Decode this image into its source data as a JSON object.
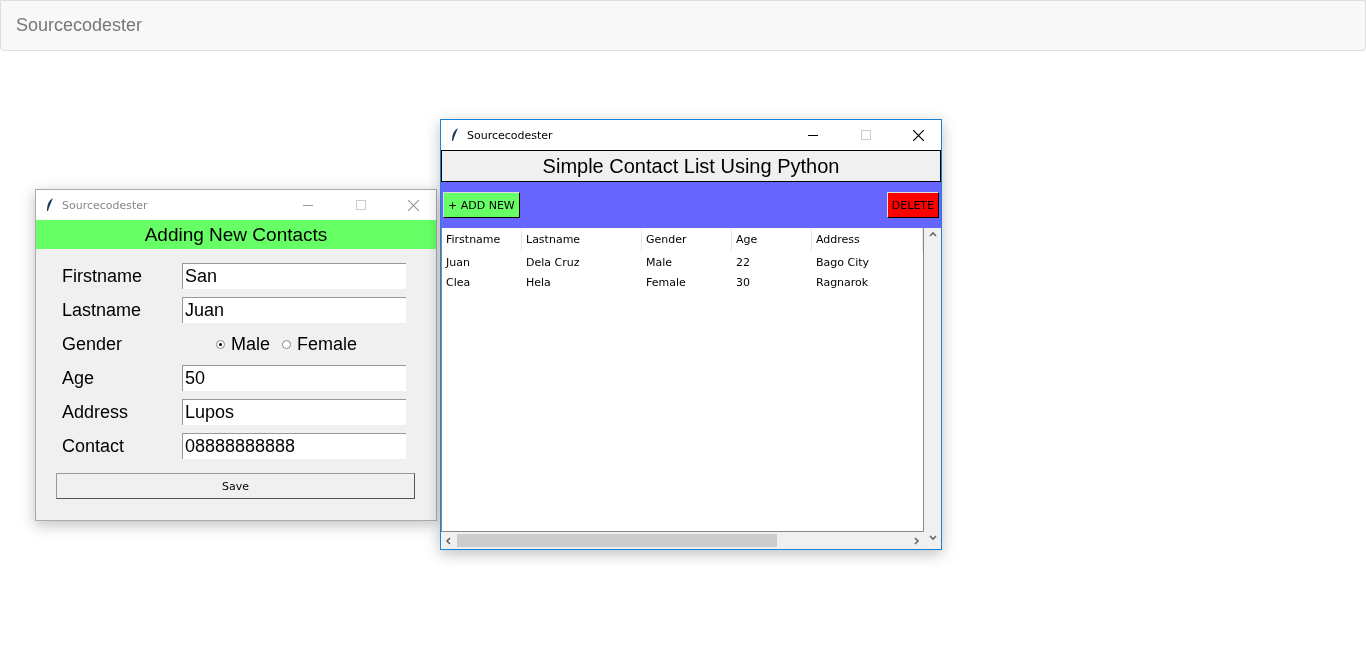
{
  "navbar": {
    "brand": "Sourcecodester"
  },
  "form_window": {
    "title": "Sourcecodester",
    "active": false,
    "heading": "Adding New Contacts",
    "fields": [
      {
        "kind": "text",
        "label": "Firstname",
        "value": "San"
      },
      {
        "kind": "text",
        "label": "Lastname",
        "value": "Juan"
      },
      {
        "kind": "radio",
        "label": "Gender",
        "options": [
          {
            "label": "Male",
            "selected": true
          },
          {
            "label": "Female",
            "selected": false
          }
        ]
      },
      {
        "kind": "text",
        "label": "Age",
        "value": "50"
      },
      {
        "kind": "text",
        "label": "Address",
        "value": "Lupos"
      },
      {
        "kind": "text",
        "label": "Contact",
        "value": "08888888888"
      }
    ],
    "save_button": "Save"
  },
  "list_window": {
    "title": "Sourcecodester",
    "active": true,
    "heading": "Simple Contact List Using Python",
    "add_button": "+ ADD NEW",
    "delete_button": "DELETE",
    "table": {
      "columns": [
        "Firstname",
        "Lastname",
        "Gender",
        "Age",
        "Address"
      ],
      "rows": [
        [
          "Juan",
          "Dela Cruz",
          "Male",
          "22",
          "Bago City"
        ],
        [
          "Clea",
          "Hela",
          "Female",
          "30",
          "Ragnarok"
        ]
      ]
    }
  }
}
